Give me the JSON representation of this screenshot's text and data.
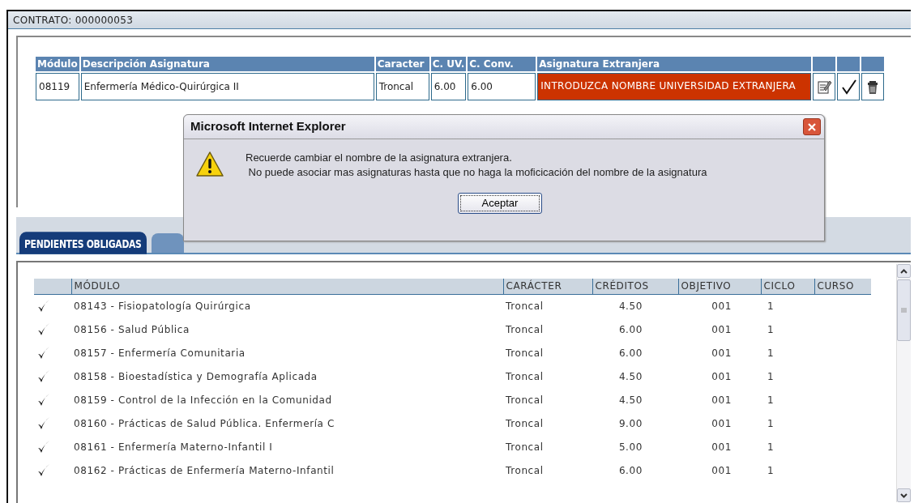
{
  "contract": {
    "label": "CONTRATO: 000000053"
  },
  "subject_table": {
    "columns": [
      "Módulo",
      "Descripción Asignatura",
      "Caracter",
      "C. UV.",
      "C. Conv.",
      "Asignatura Extranjera"
    ],
    "rows": [
      {
        "module": "08119",
        "description": "Enfermería Médico-Quirúrgica II",
        "character": "Troncal",
        "c_uv": "6.00",
        "c_conv": "6.00",
        "foreign_subject": "INTRODUZCA NOMBRE UNIVERSIDAD EXTRANJERA",
        "foreign_missing": true
      }
    ]
  },
  "tabs": [
    {
      "label": "PENDIENTES OBLIGADAS",
      "selected": true
    }
  ],
  "pending_table": {
    "columns": [
      "MÓDULO",
      "CARÁCTER",
      "CRÉDITOS",
      "OBJETIVO",
      "CICLO",
      "CURSO"
    ],
    "rows": [
      {
        "checked": true,
        "module": "08143 - Fisiopatología Quirúrgica",
        "character": "Troncal",
        "credits": "4.50",
        "objective": "001",
        "cycle": "1"
      },
      {
        "checked": true,
        "module": "08156 - Salud Pública",
        "character": "Troncal",
        "credits": "6.00",
        "objective": "001",
        "cycle": "1"
      },
      {
        "checked": true,
        "module": "08157 - Enfermería Comunitaria",
        "character": "Troncal",
        "credits": "6.00",
        "objective": "001",
        "cycle": "1"
      },
      {
        "checked": true,
        "module": "08158 - Bioestadística y Demografía Aplicada",
        "character": "Troncal",
        "credits": "4.50",
        "objective": "001",
        "cycle": "1"
      },
      {
        "checked": true,
        "module": "08159 - Control de la Infección en la Comunidad",
        "character": "Troncal",
        "credits": "4.50",
        "objective": "001",
        "cycle": "1"
      },
      {
        "checked": true,
        "module": "08160 - Prácticas de Salud Pública. Enfermería C",
        "character": "Troncal",
        "credits": "9.00",
        "objective": "001",
        "cycle": "1"
      },
      {
        "checked": true,
        "module": "08161 - Enfermería Materno-Infantil I",
        "character": "Troncal",
        "credits": "5.00",
        "objective": "001",
        "cycle": "1"
      },
      {
        "checked": true,
        "module": "08162 - Prácticas de Enfermería Materno-Infantil",
        "character": "Troncal",
        "credits": "6.00",
        "objective": "001",
        "cycle": "1"
      }
    ]
  },
  "dialog": {
    "title": "Microsoft Internet Explorer",
    "lines": [
      "Recuerde cambiar el nombre de la asignatura extranjera.",
      " No puede asociar mas asignaturas hasta que no haga la moficicación del nombre de la asignatura"
    ],
    "button": "Aceptar"
  }
}
